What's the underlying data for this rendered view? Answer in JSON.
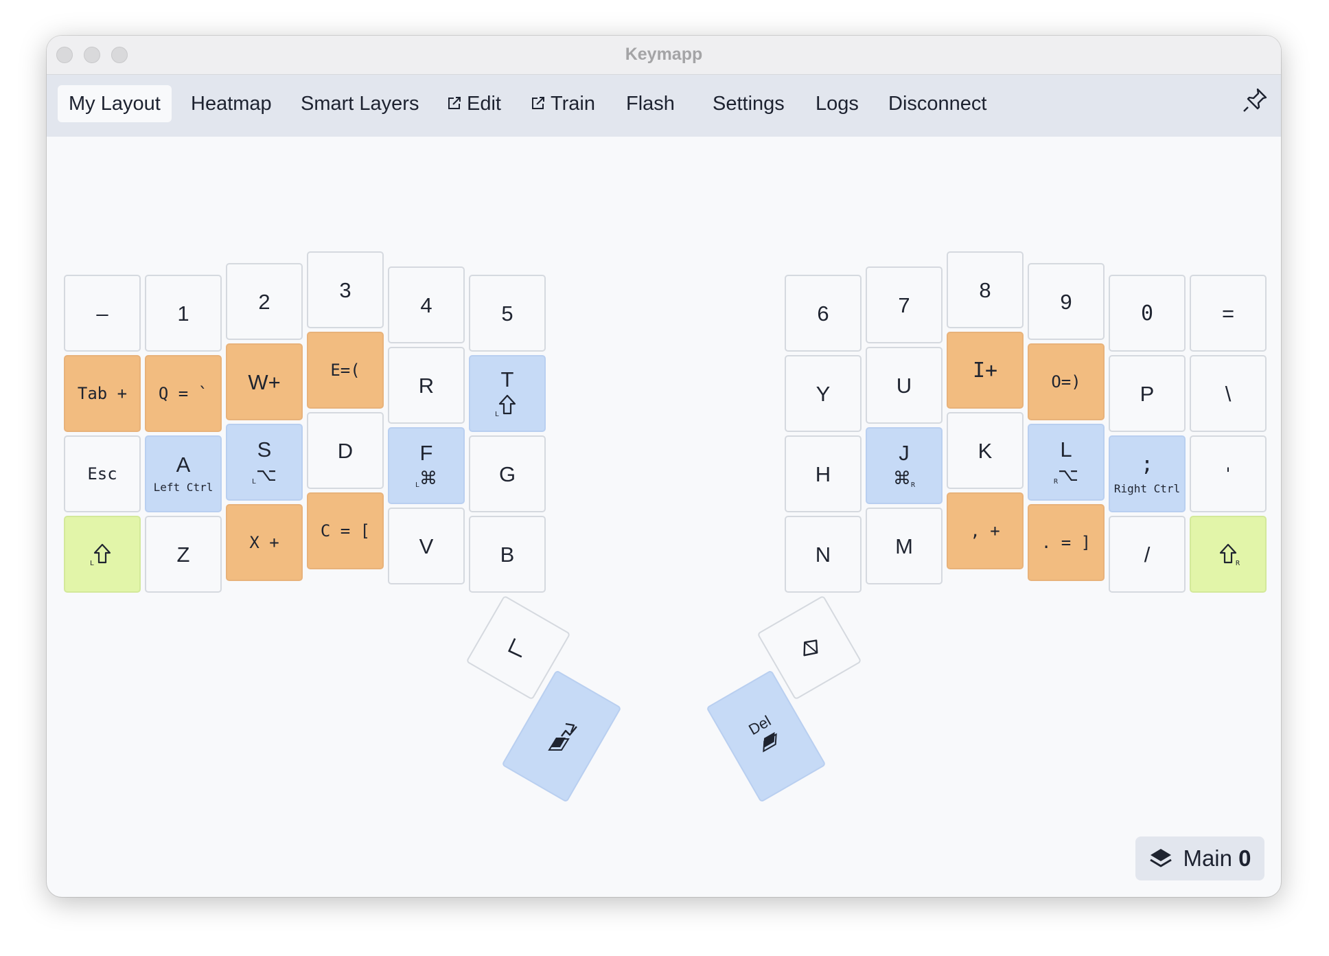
{
  "window": {
    "title": "Keymapp"
  },
  "nav": {
    "items": [
      {
        "label": "My Layout",
        "active": true
      },
      {
        "label": "Heatmap"
      },
      {
        "label": "Smart Layers"
      },
      {
        "label": "Edit",
        "external": true
      },
      {
        "label": "Train",
        "external": true
      },
      {
        "label": "Flash"
      },
      {
        "label": "Settings"
      },
      {
        "label": "Logs"
      },
      {
        "label": "Disconnect"
      }
    ]
  },
  "colors": {
    "tap_dance": "#f2bc80",
    "dual_function": "#c6daf6",
    "modifier": "#e2f5a9",
    "plain": "#f8f9fb"
  },
  "keys": {
    "l_r1_c1": "–",
    "l_r1_c2": "1",
    "l_r1_c3": "2",
    "l_r1_c4": "3",
    "l_r1_c5": "4",
    "l_r1_c6": "5",
    "l_r2_c1": "Tab +",
    "l_r2_c2": "Q = `",
    "l_r2_c3": "W+",
    "l_r2_c4": "E=(",
    "l_r2_c5": "R",
    "l_r2_c6": "T",
    "l_r3_c1": "Esc",
    "l_r3_c2": "A",
    "l_r3_c2_sub": "Left Ctrl",
    "l_r3_c3": "S",
    "l_r3_c4": "D",
    "l_r3_c5": "F",
    "l_r3_c6": "G",
    "l_r4_c2": "Z",
    "l_r4_c3": "X +",
    "l_r4_c4": "C = [",
    "l_r4_c5": "V",
    "l_r4_c6": "B",
    "r_r1_c1": "6",
    "r_r1_c2": "7",
    "r_r1_c3": "8",
    "r_r1_c4": "9",
    "r_r1_c5": "0",
    "r_r1_c6": "=",
    "r_r2_c1": "Y",
    "r_r2_c2": "U",
    "r_r2_c3": "I+",
    "r_r2_c4": "O=)",
    "r_r2_c5": "P",
    "r_r2_c6": "\\",
    "r_r3_c1": "H",
    "r_r3_c2": "J",
    "r_r3_c3": "K",
    "r_r3_c4": "L",
    "r_r3_c5": ";",
    "r_r3_c5_sub": "Right Ctrl",
    "r_r3_c6": "'",
    "r_r4_c1": "N",
    "r_r4_c2": "M",
    "r_r4_c3": ", +",
    "r_r4_c4": ". = ]",
    "r_r4_c5": "/",
    "thumb_right_big": "Del"
  },
  "symbols": {
    "cmd": "⌘",
    "opt": "⌥",
    "left_mark": "L",
    "right_mark": "R"
  },
  "layer": {
    "name": "Main",
    "index": "0"
  }
}
